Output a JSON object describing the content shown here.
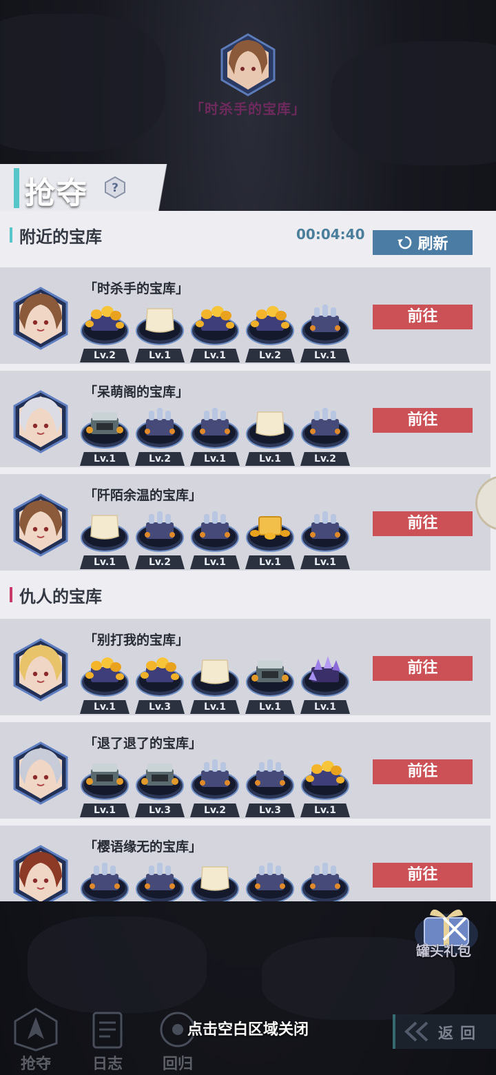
{
  "header_banner": {
    "owner_vault_title": "「时杀手的宝库」"
  },
  "page": {
    "title": "抢夺",
    "help_icon": "question-icon"
  },
  "nearby": {
    "section_title": "附近的宝库",
    "timer": "00:04:40",
    "refresh_label": "刷新",
    "vaults": [
      {
        "name": "「时杀手的宝库」",
        "avatar": "brown-hair-girl",
        "chests": [
          {
            "kind": "gold",
            "level": "Lv.2"
          },
          {
            "kind": "ore",
            "level": "Lv.1"
          },
          {
            "kind": "gold",
            "level": "Lv.1"
          },
          {
            "kind": "gold",
            "level": "Lv.2"
          },
          {
            "kind": "bottles",
            "level": "Lv.1"
          }
        ],
        "button": "前往"
      },
      {
        "name": "「呆萌阁的宝库」",
        "avatar": "white-hair-girl",
        "chests": [
          {
            "kind": "silver",
            "level": "Lv.1"
          },
          {
            "kind": "bottles",
            "level": "Lv.2"
          },
          {
            "kind": "bottles",
            "level": "Lv.1"
          },
          {
            "kind": "ore",
            "level": "Lv.1"
          },
          {
            "kind": "bottles",
            "level": "Lv.2"
          }
        ],
        "button": "前往"
      },
      {
        "name": "「阡陌余温的宝库」",
        "avatar": "brown-hair-girl",
        "chests": [
          {
            "kind": "ore",
            "level": "Lv.1"
          },
          {
            "kind": "bottles",
            "level": "Lv.2"
          },
          {
            "kind": "bottles",
            "level": "Lv.1"
          },
          {
            "kind": "goldbox",
            "level": "Lv.1"
          },
          {
            "kind": "bottles",
            "level": "Lv.1"
          }
        ],
        "button": "前往"
      }
    ]
  },
  "enemy": {
    "section_title": "仇人的宝库",
    "vaults": [
      {
        "name": "「别打我的宝库」",
        "avatar": "blonde-girl",
        "chests": [
          {
            "kind": "gold",
            "level": "Lv.1"
          },
          {
            "kind": "gold",
            "level": "Lv.3"
          },
          {
            "kind": "ore",
            "level": "Lv.1"
          },
          {
            "kind": "silver",
            "level": "Lv.1"
          },
          {
            "kind": "crystal",
            "level": "Lv.1"
          }
        ],
        "button": "前往"
      },
      {
        "name": "「退了退了的宝库」",
        "avatar": "silver-hair-girl",
        "chests": [
          {
            "kind": "silver",
            "level": "Lv.1"
          },
          {
            "kind": "silver",
            "level": "Lv.3"
          },
          {
            "kind": "bottles",
            "level": "Lv.2"
          },
          {
            "kind": "bottles",
            "level": "Lv.3"
          },
          {
            "kind": "gold",
            "level": "Lv.1"
          }
        ],
        "button": "前往"
      },
      {
        "name": "「樱语缘无的宝库」",
        "avatar": "auburn-hair-girl",
        "chests": [
          {
            "kind": "bottles",
            "level": ""
          },
          {
            "kind": "bottles",
            "level": ""
          },
          {
            "kind": "ore",
            "level": ""
          },
          {
            "kind": "bottles",
            "level": ""
          },
          {
            "kind": "bottles",
            "level": ""
          }
        ],
        "button": "前往"
      }
    ]
  },
  "gift": {
    "label": "罐头礼包",
    "icon": "gift-box-icon"
  },
  "close_hint": "点击空白区域关闭",
  "bottom_nav": [
    {
      "label": "抢夺",
      "icon": "plunder-icon"
    },
    {
      "label": "日志",
      "icon": "log-icon"
    },
    {
      "label": "回归",
      "icon": "return-icon"
    }
  ],
  "back_label": "返回",
  "colors": {
    "accent_teal": "#56c6c8",
    "enemy_pink": "#c83a6a",
    "go_button": "#cb5157",
    "refresh_button": "#4a7ca4",
    "timer": "#4a7e9a"
  }
}
